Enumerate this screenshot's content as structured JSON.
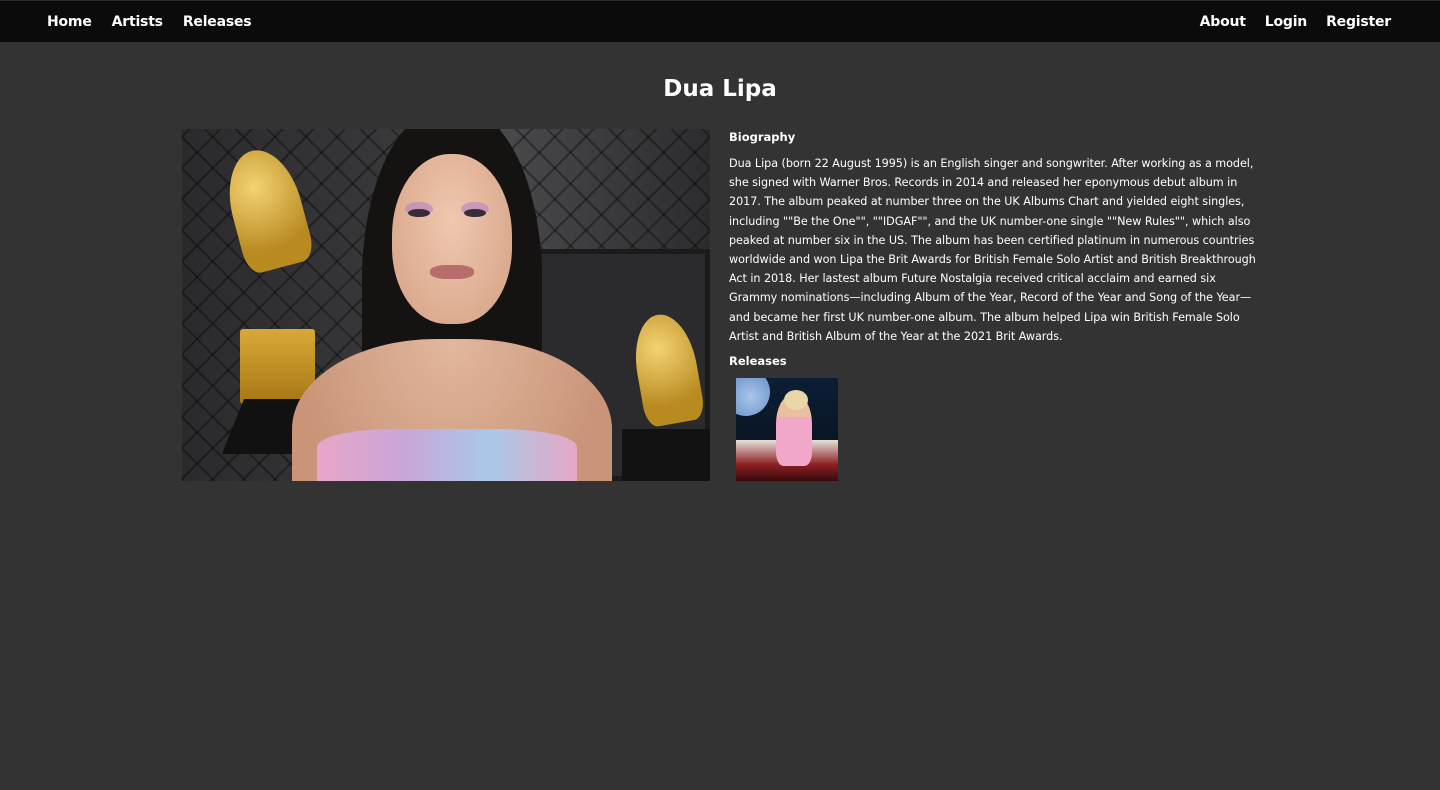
{
  "nav": {
    "left": [
      {
        "label": "Home"
      },
      {
        "label": "Artists"
      },
      {
        "label": "Releases"
      }
    ],
    "right": [
      {
        "label": "About"
      },
      {
        "label": "Login"
      },
      {
        "label": "Register"
      }
    ]
  },
  "artist": {
    "name": "Dua Lipa",
    "biography_heading": "Biography",
    "biography": "Dua Lipa (born 22 August 1995) is an English singer and songwriter. After working as a model, she signed with Warner Bros. Records in 2014 and released her eponymous debut album in 2017. The album peaked at number three on the UK Albums Chart and yielded eight singles, including \"\"Be the One\"\", \"\"IDGAF\"\", and the UK number-one single \"\"New Rules\"\", which also peaked at number six in the US. The album has been certified platinum in numerous countries worldwide and won Lipa the Brit Awards for British Female Solo Artist and British Breakthrough Act in 2018. Her lastest album Future Nostalgia received critical acclaim and earned six Grammy nominations—including Album of the Year, Record of the Year and Song of the Year—and became her first UK number-one album. The album helped Lipa win British Female Solo Artist and British Album of the Year at the 2021 Brit Awards.",
    "releases_heading": "Releases"
  },
  "colors": {
    "background": "#333333",
    "topbar": "#0b0b0b",
    "text": "#ffffff"
  }
}
